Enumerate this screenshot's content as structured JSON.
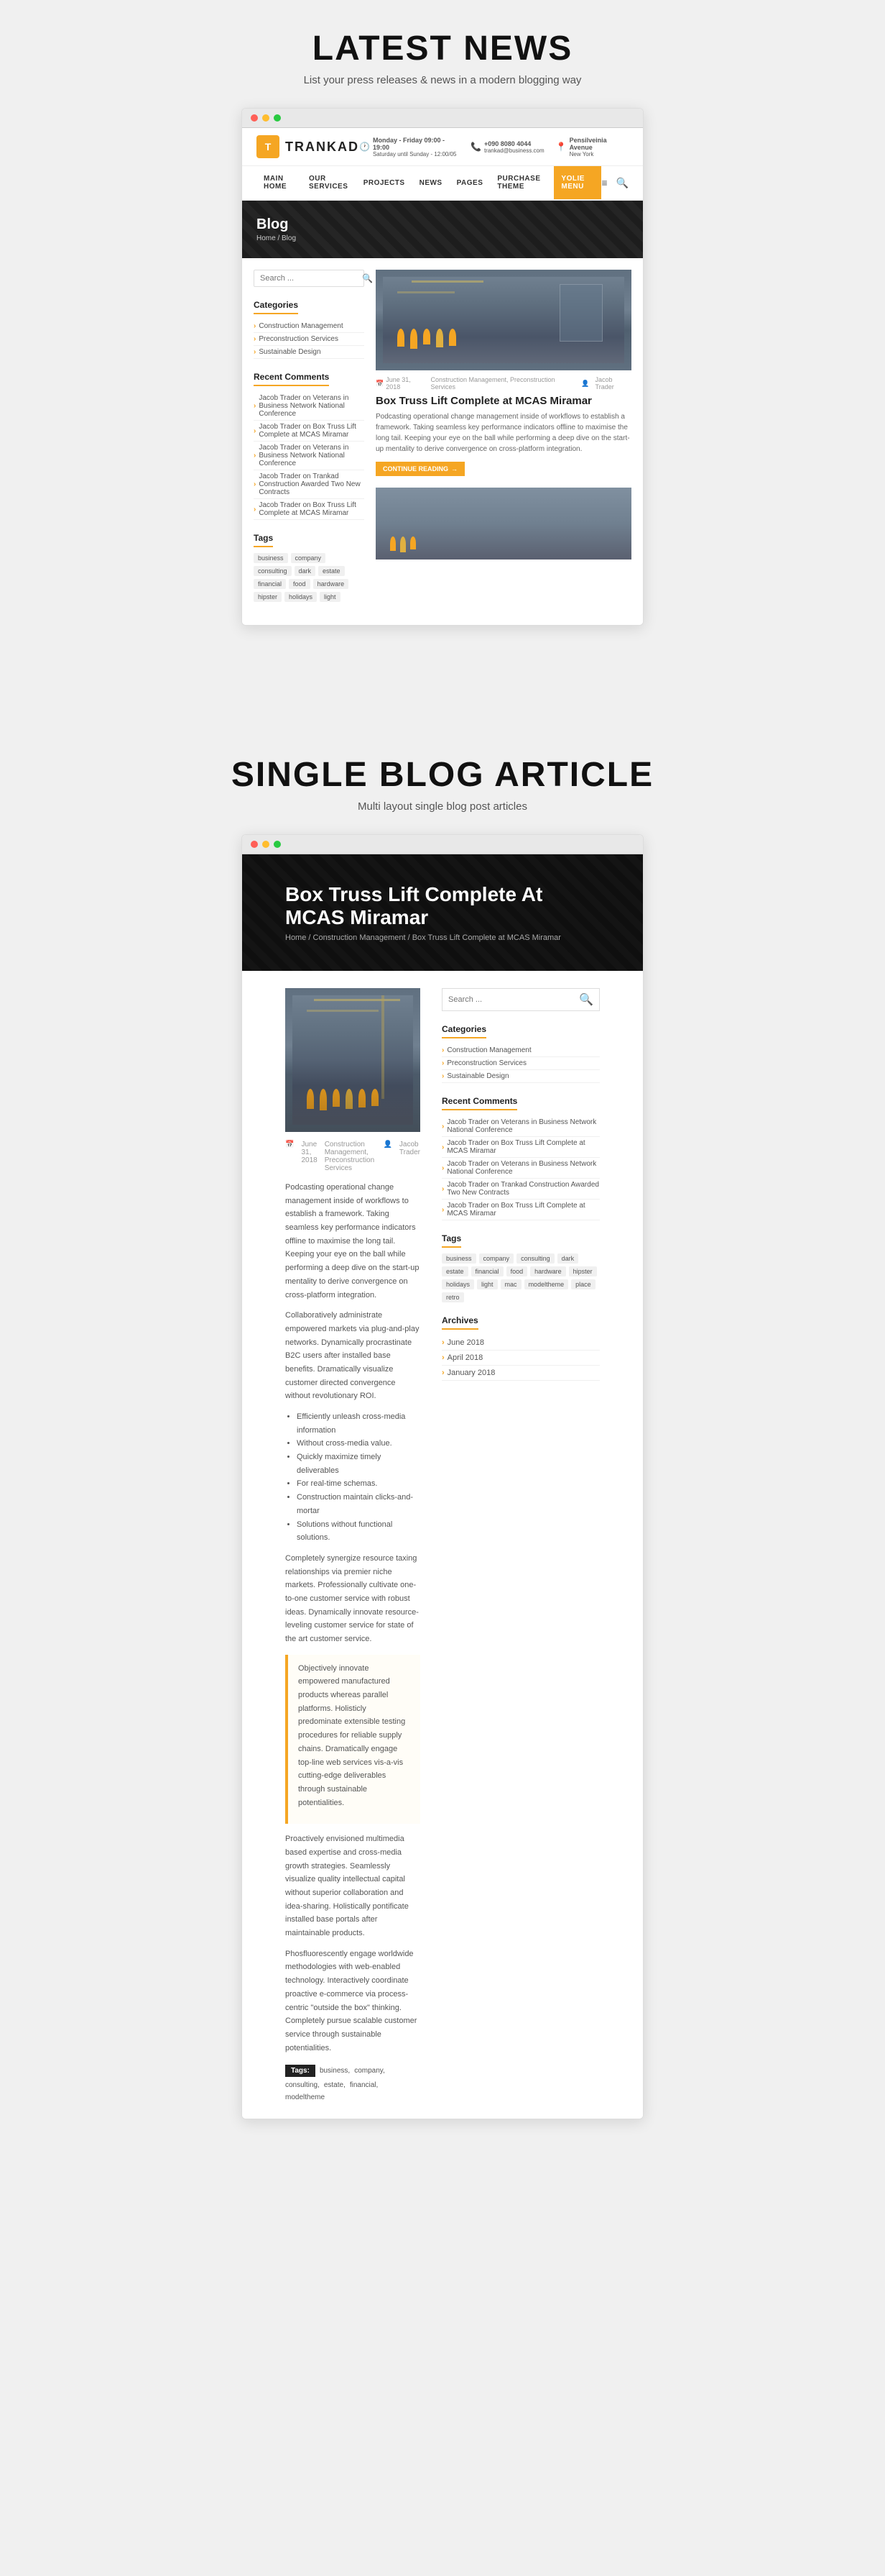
{
  "section1": {
    "title": "LATEST NEWS",
    "subtitle": "List your press releases & news in a modern blogging way"
  },
  "section2": {
    "title": "SINGLE BLOG ARTICLE",
    "subtitle": "Multi layout single blog post articles"
  },
  "header": {
    "logo": "T",
    "brand": "TRANKAD",
    "hours_icon": "🕐",
    "hours_label": "Monday - Friday 09:00 - 19:00",
    "hours_sub": "Saturday until Sunday - 12:00/05",
    "phone_icon": "📞",
    "phone": "+090 8080 4044",
    "phone_email": "trankad@business.com",
    "address_icon": "📍",
    "address": "Pensilveinia Avenue",
    "address_sub": "New York"
  },
  "nav": {
    "items": [
      {
        "label": "MAIN HOME",
        "active": false
      },
      {
        "label": "OUR SERVICES",
        "active": false
      },
      {
        "label": "PROJECTS",
        "active": false
      },
      {
        "label": "NEWS",
        "active": false
      },
      {
        "label": "PAGES",
        "active": false
      },
      {
        "label": "PURCHASE THEME",
        "active": false
      },
      {
        "label": "YOLIE MENU",
        "active": true
      }
    ]
  },
  "hero": {
    "title": "Blog",
    "breadcrumb": "Home / Blog"
  },
  "single_hero": {
    "title": "Box Truss Lift Complete At MCAS Miramar",
    "breadcrumb": "Home / Construction Management / Box Truss Lift Complete at MCAS Miramar"
  },
  "sidebar": {
    "search_placeholder": "Search ...",
    "categories_title": "Categories",
    "categories": [
      "Construction Management",
      "Preconstruction Services",
      "Sustainable Design"
    ],
    "recent_comments_title": "Recent Comments",
    "recent_comments": [
      "Jacob Trader on Veterans in Business Network National Conference",
      "Jacob Trader on Box Truss Lift Complete at MCAS Miramar",
      "Jacob Trader on Veterans in Business Network National Conference",
      "Jacob Trader on Trankad Construction Awarded Two New Contracts",
      "Jacob Trader on Box Truss Lift Complete at MCAS Miramar"
    ],
    "tags_title": "Tags",
    "tags": [
      "business",
      "company",
      "consulting",
      "dark",
      "estate",
      "financial",
      "food",
      "hardware",
      "hipster",
      "holidays",
      "light"
    ]
  },
  "article_sidebar": {
    "search_placeholder": "Search ...",
    "categories_title": "Categories",
    "categories": [
      "Construction Management",
      "Preconstruction Services",
      "Sustainable Design"
    ],
    "recent_comments_title": "Recent Comments",
    "recent_comments": [
      "Jacob Trader on Veterans in Business Network National Conference",
      "Jacob Trader on Box Truss Lift Complete at MCAS Miramar",
      "Jacob Trader on Veterans in Business Network National Conference",
      "Jacob Trader on Trankad Construction Awarded Two New Contracts",
      "Jacob Trader on Box Truss Lift Complete at MCAS Miramar"
    ],
    "tags_title": "Tags",
    "tags": [
      "business",
      "company",
      "consulting",
      "dark",
      "estate",
      "financial",
      "food",
      "hardware",
      "hipster",
      "holidays",
      "light",
      "mac",
      "modeltheme",
      "place",
      "retro"
    ],
    "archives_title": "Archives",
    "archives": [
      "June 2018",
      "April 2018",
      "January 2018"
    ]
  },
  "post1": {
    "date": "June 31, 2018",
    "categories": "Construction Management, Preconstruction Services",
    "author": "Jacob Trader",
    "title": "Box Truss Lift Complete at MCAS Miramar",
    "excerpt": "Podcasting operational change management inside of workflows to establish a framework. Taking seamless key performance indicators offline to maximise the long tail. Keeping your eye on the ball while performing a deep dive on the start-up mentality to derive convergence on cross-platform integration.",
    "read_more": "CONTINUE READING"
  },
  "article": {
    "date": "June 31, 2018",
    "categories": "Construction Management, Preconstruction Services",
    "author": "Jacob Trader",
    "body1": "Podcasting operational change management inside of workflows to establish a framework. Taking seamless key performance indicators offline to maximise the long tail. Keeping your eye on the ball while performing a deep dive on the start-up mentality to derive convergence on cross-platform integration.",
    "body2": "Collaboratively administrate empowered markets via plug-and-play networks. Dynamically procrastinate B2C users after installed base benefits. Dramatically visualize customer directed convergence without revolutionary ROI.",
    "list_items": [
      "Efficiently unleash cross-media information",
      "Without cross-media value.",
      "Quickly maximize timely deliverables",
      "For real-time schemas.",
      "Construction maintain clicks-and-mortar",
      "Solutions without functional solutions."
    ],
    "body3": "Completely synergize resource taxing relationships via premier niche markets. Professionally cultivate one-to-one customer service with robust ideas. Dynamically innovate resource-leveling customer service for state of the art customer service.",
    "blockquote": "Objectively innovate empowered manufactured products whereas parallel platforms. Holisticly predominate extensible testing procedures for reliable supply chains. Dramatically engage top-line web services vis-a-vis cutting-edge deliverables through sustainable potentialities.",
    "body4": "Proactively envisioned multimedia based expertise and cross-media growth strategies. Seamlessly visualize quality intellectual capital without superior collaboration and idea-sharing. Holistically pontificate installed base portals after maintainable products.",
    "body5": "Phosfluorescently engage worldwide methodologies with web-enabled technology. Interactively coordinate proactive e-commerce via process-centric \"outside the box\" thinking. Completely pursue scalable customer service through sustainable potentialities.",
    "tags_label": "Tags:",
    "tags": [
      "business",
      "company",
      "consulting",
      "estate",
      "financial",
      "modeltheme"
    ]
  }
}
